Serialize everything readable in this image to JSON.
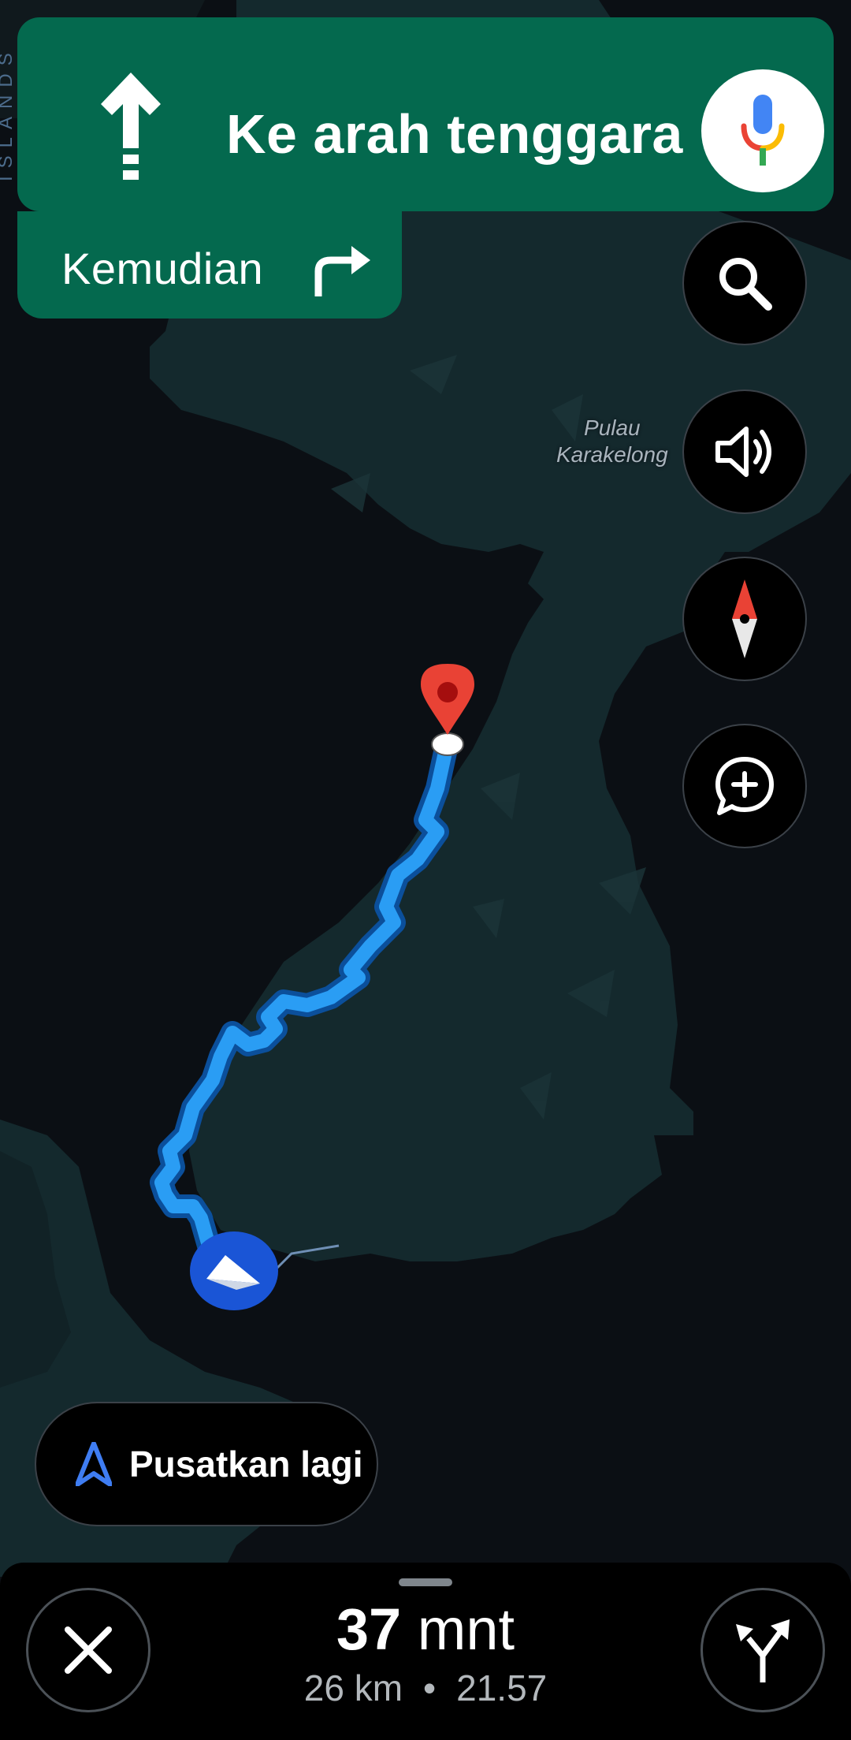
{
  "banner": {
    "instruction": "Ke arah tenggara",
    "then_label": "Kemudian"
  },
  "map": {
    "island_label_line1": "Pulau",
    "island_label_line2": "Karakelong",
    "side_label": "ISLANDS"
  },
  "buttons": {
    "recenter_label": "Pusatkan lagi"
  },
  "trip": {
    "duration_value": "37",
    "duration_unit": "mnt",
    "distance": "26 km",
    "separator": "•",
    "arrival_time": "21.57"
  },
  "colors": {
    "banner_green": "#04694e",
    "route_blue": "#2a9df4",
    "destination_pin": "#e94235",
    "location_marker": "#1a55d6"
  },
  "icons": [
    "straight-arrow-icon",
    "mic-icon",
    "turn-right-icon",
    "search-icon",
    "volume-icon",
    "compass-icon",
    "add-report-icon",
    "recenter-arrow-icon",
    "close-icon",
    "alternate-routes-icon",
    "destination-pin-icon",
    "current-location-icon"
  ]
}
